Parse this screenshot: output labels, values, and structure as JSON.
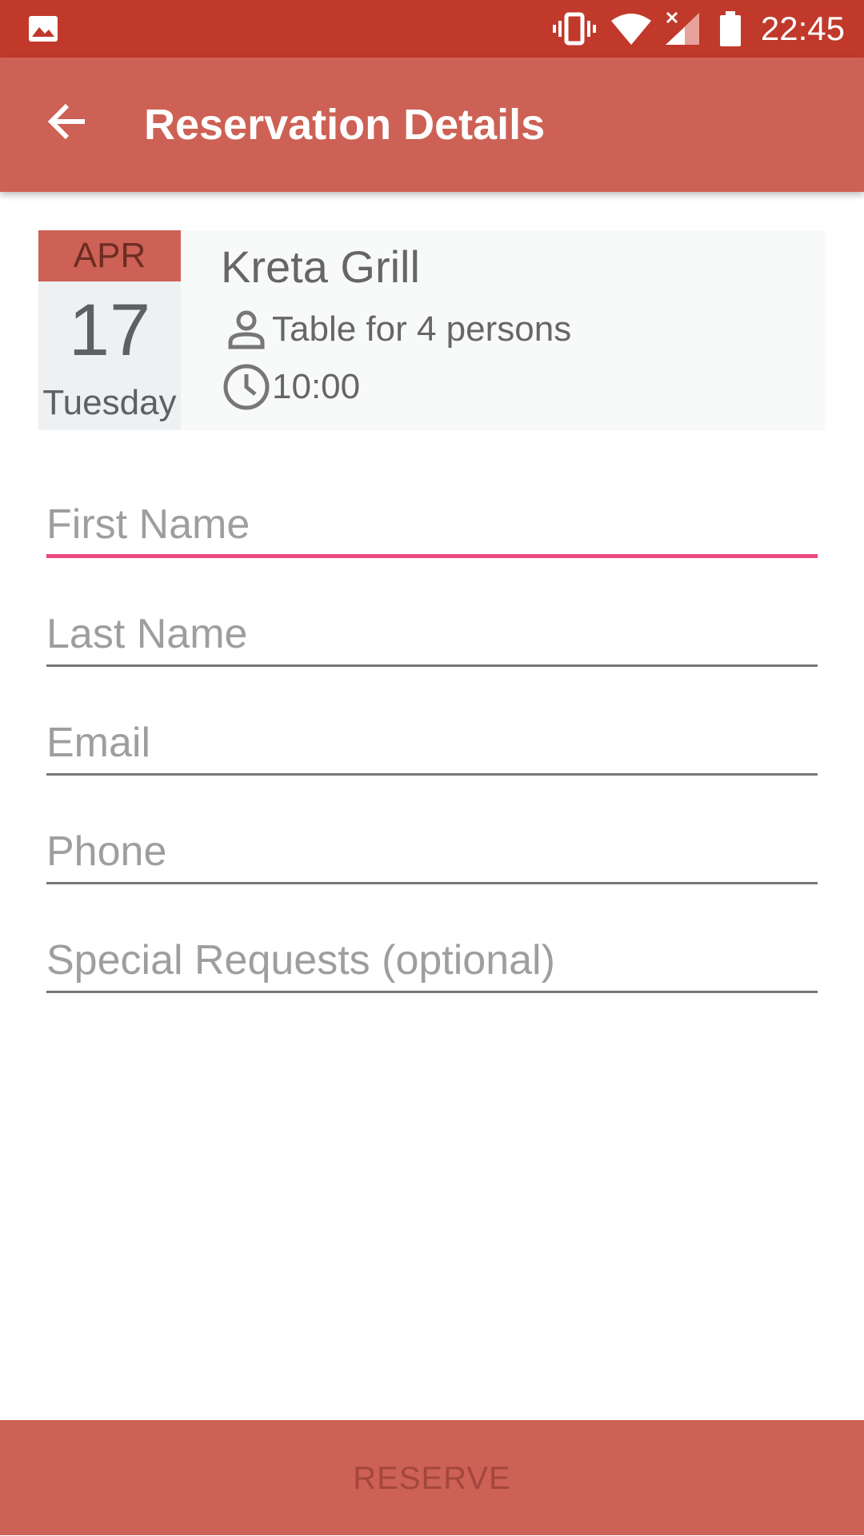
{
  "status_bar": {
    "time": "22:45",
    "icons": [
      "gallery-icon",
      "vibrate-icon",
      "wifi-icon",
      "signal-icon",
      "battery-icon"
    ]
  },
  "app_bar": {
    "title": "Reservation Details",
    "back_icon": "arrow-back-icon"
  },
  "reservation": {
    "month": "APR",
    "day": "17",
    "weekday": "Tuesday",
    "restaurant": "Kreta Grill",
    "party": "Table for 4 persons",
    "time": "10:00"
  },
  "form": {
    "first_name_placeholder": "First Name",
    "last_name_placeholder": "Last Name",
    "email_placeholder": "Email",
    "phone_placeholder": "Phone",
    "special_requests_placeholder": "Special Requests (optional)"
  },
  "actions": {
    "reserve_label": "RESERVE"
  },
  "colors": {
    "status_bar": "#c0392b",
    "app_bar": "#cd6155",
    "focus_underline": "#e84a7f",
    "reserve_text": "#a3473e"
  }
}
